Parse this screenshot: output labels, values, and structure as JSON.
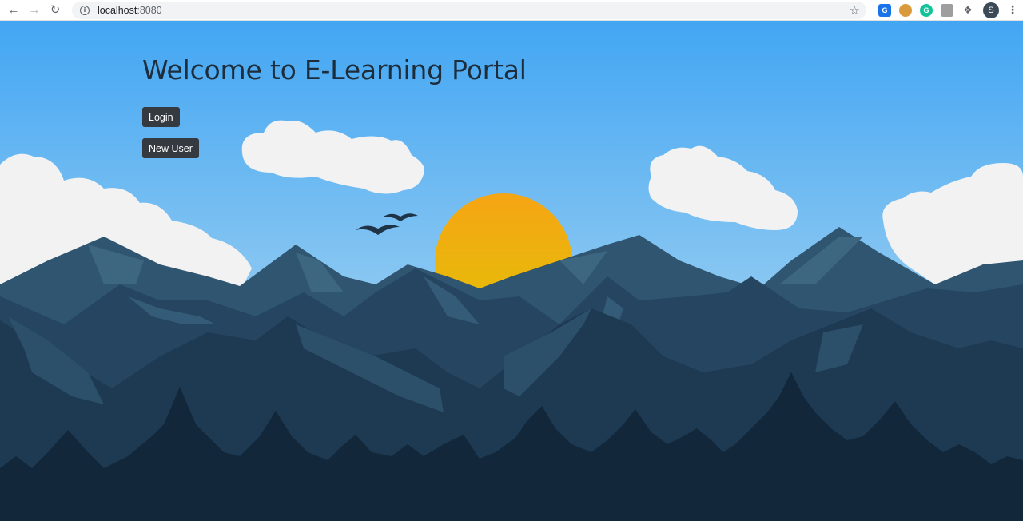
{
  "browser": {
    "url_host": "localhost",
    "url_port": ":8080",
    "profile_initial": "S",
    "icons": {
      "back": "back-arrow-icon",
      "forward": "forward-arrow-icon",
      "reload": "reload-icon",
      "info": "info-icon",
      "bookmark": "star-icon",
      "extensions": [
        "translate-extension-icon",
        "cookie-extension-icon",
        "grammarly-extension-icon",
        "pdf-extension-icon",
        "puzzle-extensions-icon"
      ],
      "menu": "kebab-menu-icon"
    }
  },
  "page": {
    "heading": "Welcome to E-Learning Portal",
    "login_label": "Login",
    "new_user_label": "New User"
  },
  "colors": {
    "sky_top": "#42a6f3",
    "sky_bottom": "#8cc8f2",
    "sun": "#f2b516",
    "button_bg": "#343a40",
    "heading": "#1e2d3b"
  }
}
